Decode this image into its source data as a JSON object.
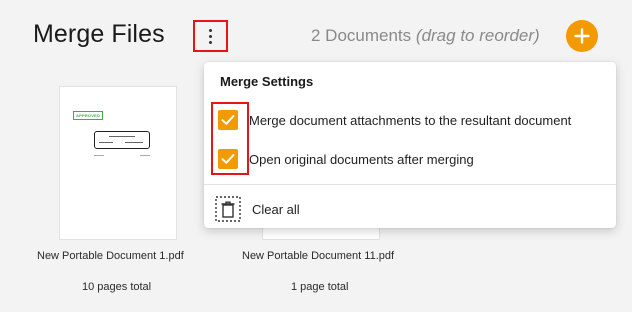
{
  "header": {
    "title": "Merge Files",
    "doc_count": "2 Documents",
    "reorder_hint": "(drag to reorder)",
    "more_icon": "more-vertical-icon",
    "add_icon": "plus-icon"
  },
  "documents": [
    {
      "name": "New Portable Document 1.pdf",
      "pages": "10 pages total",
      "stamp": "APPROVED"
    },
    {
      "name": "New Portable Document 11.pdf",
      "pages": "1 page total"
    }
  ],
  "menu": {
    "title": "Merge Settings",
    "options": [
      {
        "label": "Merge document attachments to the resultant document",
        "checked": true
      },
      {
        "label": "Open original documents after merging",
        "checked": true
      }
    ],
    "clear_all": "Clear all",
    "clear_icon": "clear-selection-icon"
  },
  "colors": {
    "accent": "#f29a00",
    "highlight": "#e8141a",
    "background": "#f3f3f3"
  }
}
